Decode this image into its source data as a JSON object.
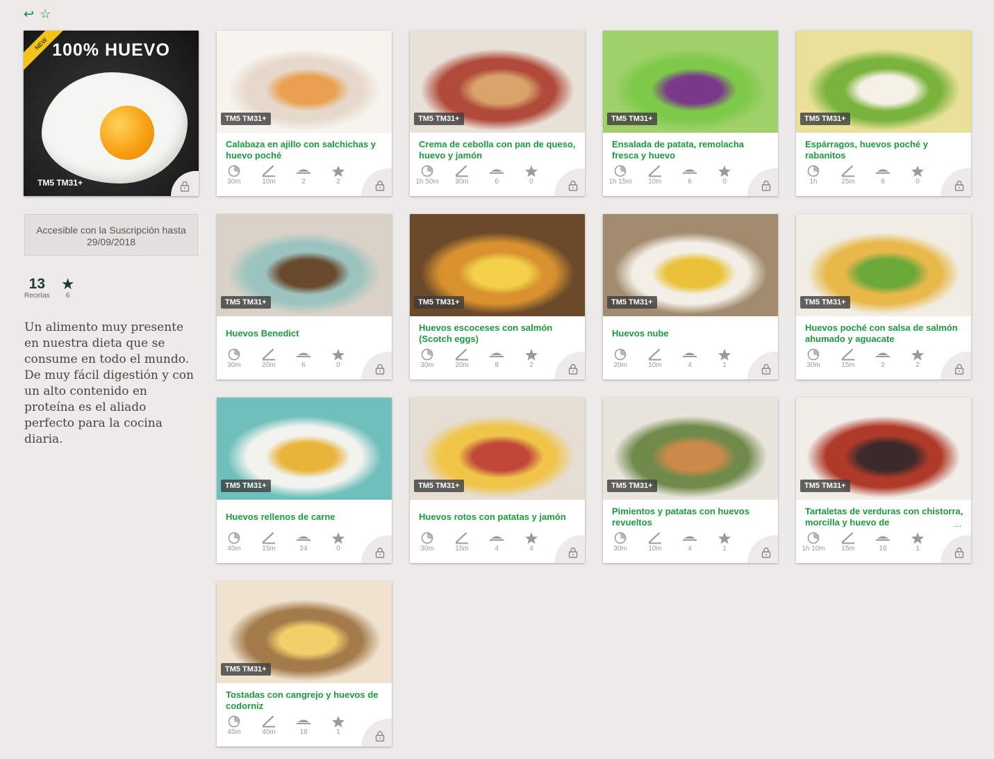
{
  "nav": {
    "back_icon": "↩",
    "favorite_icon": "☆"
  },
  "collection": {
    "title": "100% HUEVO",
    "new_label": "NEW",
    "badges": "TM5  TM31+",
    "subscription": "Accesible con la Suscripción hasta 29/09/2018",
    "recipes_count": "13",
    "recipes_label": "Recetas",
    "favorites_count": "6",
    "description": "Un alimento muy presente en nuestra dieta que se consume en todo el mundo. De muy fácil digestión y con un alto contenido en proteína es el aliado perfecto para la cocina diaria."
  },
  "badges_text": "TM5  TM31+",
  "recipes": [
    {
      "title": "Calabaza en ajillo con salchichas y huevo poché",
      "total": "30m",
      "prep": "10m",
      "portions": "2",
      "rating": "2",
      "colors": [
        "#f7f3ee",
        "#e6d9cc",
        "#e9a14f"
      ]
    },
    {
      "title": "Crema de cebolla con pan de queso, huevo y jamón",
      "total": "1h 50m",
      "prep": "30m",
      "portions": "6",
      "rating": "0",
      "colors": [
        "#e8e1d8",
        "#b04a3a",
        "#d9a46a"
      ]
    },
    {
      "title": "Ensalada de patata, remolacha fresca y huevo",
      "total": "1h 15m",
      "prep": "10m",
      "portions": "6",
      "rating": "0",
      "colors": [
        "#9fd06a",
        "#7ec94a",
        "#7a3a8a"
      ]
    },
    {
      "title": "Espárragos, huevos poché y rabanitos",
      "total": "1h",
      "prep": "25m",
      "portions": "6",
      "rating": "0",
      "colors": [
        "#e9e19a",
        "#7ab33c",
        "#f6f1e6"
      ]
    },
    {
      "title": "Huevos Benedict",
      "total": "30m",
      "prep": "20m",
      "portions": "6",
      "rating": "0",
      "colors": [
        "#d9d2c8",
        "#9cc4bf",
        "#6a4a2e"
      ]
    },
    {
      "title": "Huevos escoceses con salmón (Scotch eggs)",
      "total": "30m",
      "prep": "20m",
      "portions": "8",
      "rating": "2",
      "colors": [
        "#6a4a2a",
        "#d8912e",
        "#f3d14a"
      ]
    },
    {
      "title": "Huevos nube",
      "total": "20m",
      "prep": "10m",
      "portions": "4",
      "rating": "1",
      "colors": [
        "#a28b6e",
        "#f3efe6",
        "#e9c23a"
      ]
    },
    {
      "title": "Huevos poché con salsa de salmón ahumado y aguacate",
      "total": "30m",
      "prep": "15m",
      "portions": "2",
      "rating": "2",
      "colors": [
        "#f1ede4",
        "#e9b84a",
        "#6aa83a"
      ]
    },
    {
      "title": "Huevos rellenos de carne",
      "total": "40m",
      "prep": "15m",
      "portions": "24",
      "rating": "0",
      "colors": [
        "#6fc0bd",
        "#f2f2ee",
        "#e9b43a"
      ]
    },
    {
      "title": "Huevos rotos con patatas y jamón",
      "total": "30m",
      "prep": "15m",
      "portions": "4",
      "rating": "4",
      "colors": [
        "#e6ddd3",
        "#f0c54a",
        "#c0473a"
      ]
    },
    {
      "title": "Pimientos y patatas con huevos revueltos",
      "total": "30m",
      "prep": "10m",
      "portions": "4",
      "rating": "1",
      "colors": [
        "#e9e4dc",
        "#6f8a4a",
        "#c98a4a"
      ]
    },
    {
      "title": "Tartaletas de verduras con chistorra, morcilla y huevo de",
      "total": "1h 10m",
      "prep": "15m",
      "portions": "16",
      "rating": "1",
      "colors": [
        "#f1eee9",
        "#b03a2a",
        "#3a2a2a"
      ],
      "more": "..."
    },
    {
      "title": "Tostadas con cangrejo y huevos de codorniz",
      "total": "45m",
      "prep": "40m",
      "portions": "18",
      "rating": "1",
      "colors": [
        "#efe3d0",
        "#a47b4a",
        "#f3d06a"
      ]
    }
  ]
}
